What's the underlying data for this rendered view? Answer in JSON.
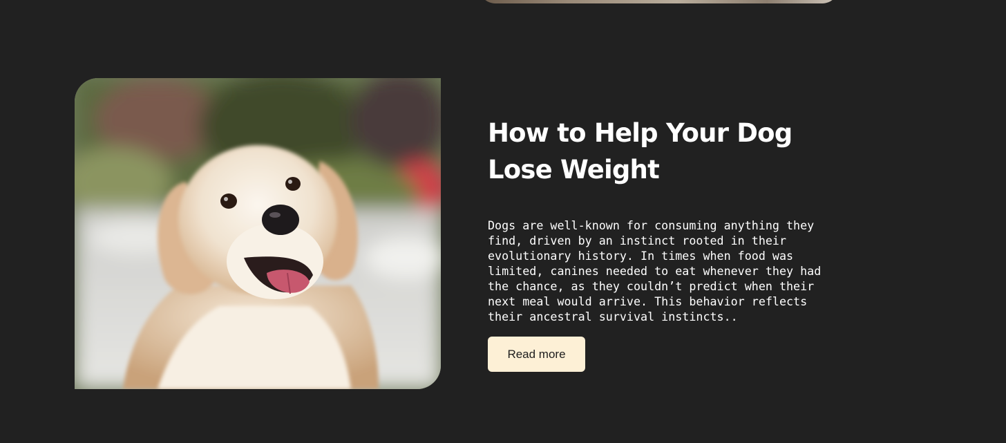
{
  "post": {
    "title": "How to Help Your Dog Lose Weight",
    "excerpt": "Dogs are well-known for consuming anything they find, driven by an instinct rooted in their evolutionary history. In times when food was limited, canines needed to eat whenever they had the chance, as they couldn’t predict when their next meal would arrive. This behavior reflects their ancestral survival instincts..",
    "read_more_label": "Read more",
    "image": "golden-retriever-photo"
  },
  "colors": {
    "background": "#212121",
    "button_background": "#fdf0d6",
    "text": "#ffffff"
  }
}
